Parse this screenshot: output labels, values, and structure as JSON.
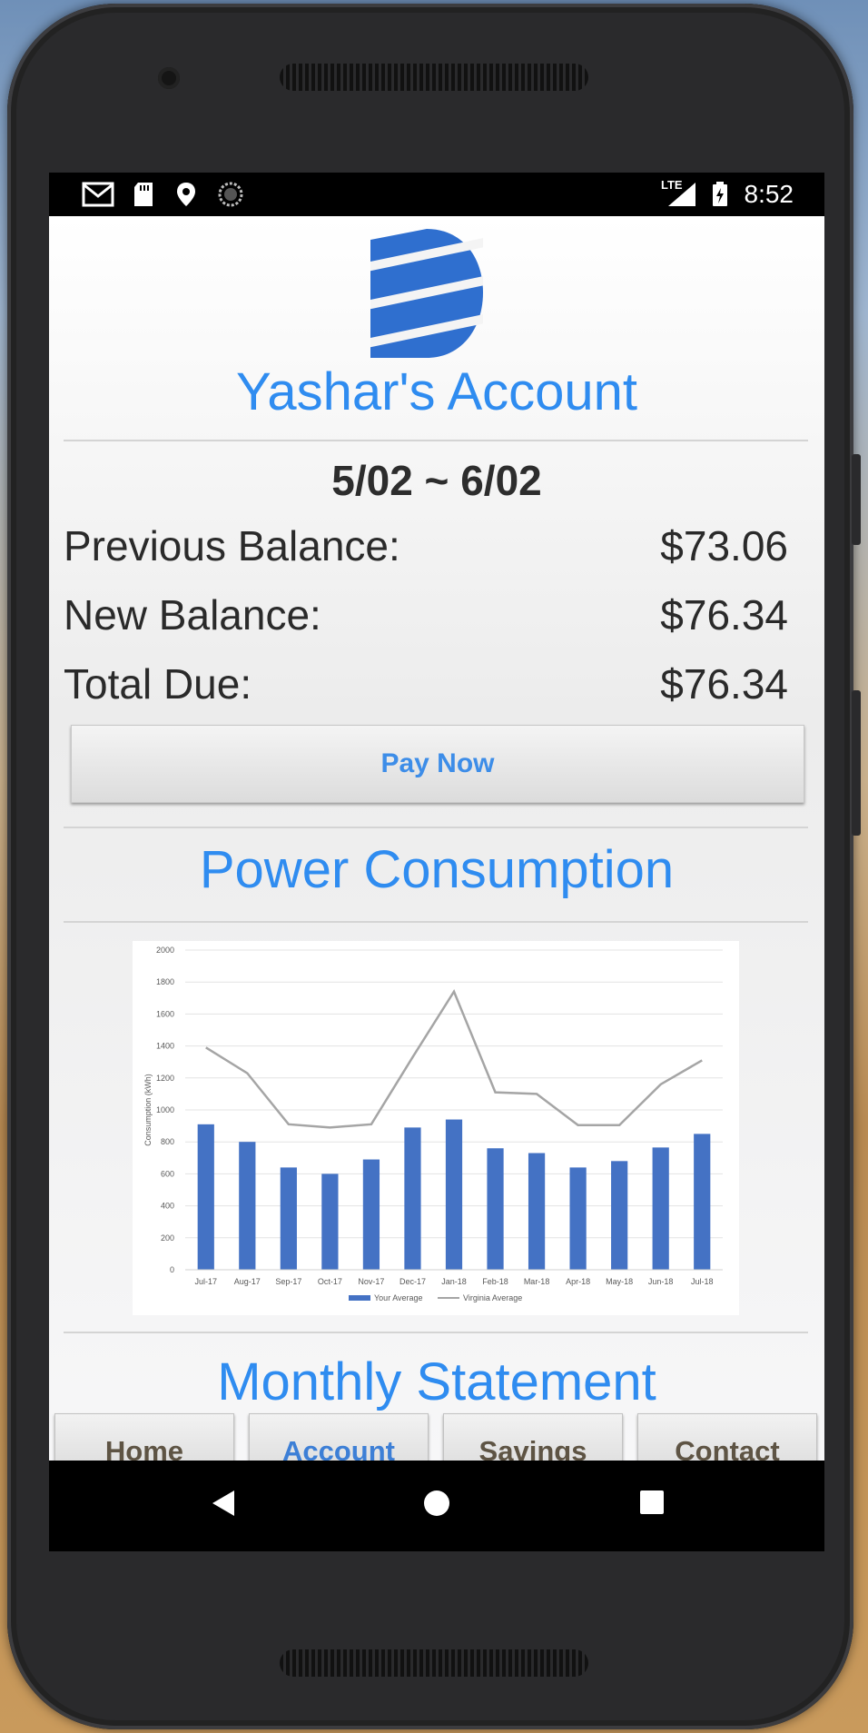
{
  "status_bar": {
    "time": "8:52",
    "network": "LTE",
    "icons": [
      "gmail-icon",
      "sd-card-icon",
      "location-icon",
      "sync-icon",
      "signal-icon",
      "battery-charging-icon"
    ]
  },
  "header": {
    "logo_icon": "company-logo-icon",
    "title": "Yashar's Account"
  },
  "billing": {
    "period": "5/02 ~ 6/02",
    "rows": [
      {
        "label": "Previous Balance:",
        "value": "$73.06"
      },
      {
        "label": "New Balance:",
        "value": "$76.34"
      },
      {
        "label": "Total Due:",
        "value": "$76.34"
      }
    ],
    "pay_button": "Pay Now"
  },
  "consumption": {
    "title": "Power Consumption"
  },
  "chart_data": {
    "type": "bar",
    "categories": [
      "Jul-17",
      "Aug-17",
      "Sep-17",
      "Oct-17",
      "Nov-17",
      "Dec-17",
      "Jan-18",
      "Feb-18",
      "Mar-18",
      "Apr-18",
      "May-18",
      "Jun-18",
      "Jul-18"
    ],
    "series": [
      {
        "name": "Your Average",
        "type": "bar",
        "color": "#4472c4",
        "values": [
          910,
          800,
          640,
          600,
          690,
          890,
          940,
          760,
          730,
          640,
          680,
          765,
          850
        ]
      },
      {
        "name": "Virginia Average",
        "type": "line",
        "color": "#a5a5a5",
        "values": [
          1390,
          1230,
          910,
          890,
          910,
          1330,
          1740,
          1110,
          1100,
          905,
          905,
          1160,
          1310
        ]
      }
    ],
    "ylabel": "Consumption (kWh)",
    "xlabel": "",
    "ylim": [
      0,
      2000
    ],
    "yticks": [
      0,
      200,
      400,
      600,
      800,
      1000,
      1200,
      1400,
      1600,
      1800,
      2000
    ],
    "grid": true,
    "legend": "bottom"
  },
  "next_section": {
    "title_partial": "Monthly Statement"
  },
  "bottom_nav": {
    "items": [
      {
        "label": "Home",
        "active": false
      },
      {
        "label": "Account",
        "active": true
      },
      {
        "label": "Savings",
        "active": false
      },
      {
        "label": "Contact",
        "active": false
      }
    ]
  },
  "system_nav": {
    "icons": [
      "back-icon",
      "home-icon",
      "recents-icon"
    ]
  },
  "colors": {
    "accent": "#2f8cf0",
    "bar": "#4472c4",
    "line": "#a5a5a5",
    "nav_text": "#5e5444"
  }
}
